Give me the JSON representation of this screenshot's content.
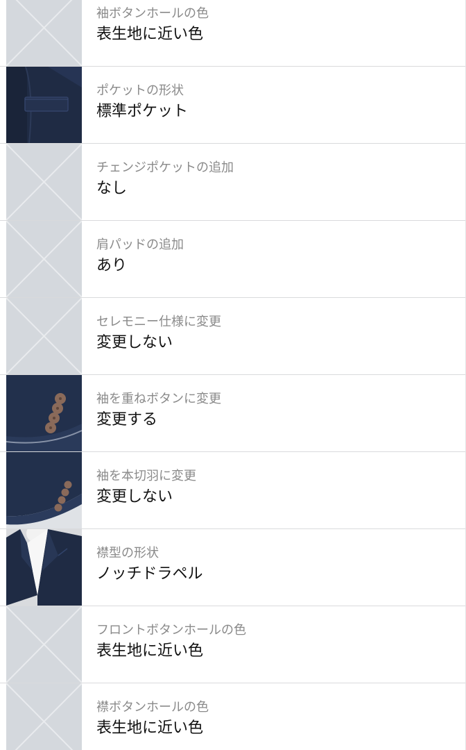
{
  "options": [
    {
      "label": "袖ボタンホールの色",
      "value": "表生地に近い色",
      "image": "placeholder"
    },
    {
      "label": "ポケットの形状",
      "value": "標準ポケット",
      "image": "pocket-photo"
    },
    {
      "label": "チェンジポケットの追加",
      "value": "なし",
      "image": "placeholder"
    },
    {
      "label": "肩パッドの追加",
      "value": "あり",
      "image": "placeholder"
    },
    {
      "label": "セレモニー仕様に変更",
      "value": "変更しない",
      "image": "placeholder"
    },
    {
      "label": "袖を重ねボタンに変更",
      "value": "変更する",
      "image": "sleeve-stacked-buttons-photo"
    },
    {
      "label": "袖を本切羽に変更",
      "value": "変更しない",
      "image": "sleeve-buttons-photo"
    },
    {
      "label": "襟型の形状",
      "value": "ノッチドラペル",
      "image": "lapel-photo"
    },
    {
      "label": "フロントボタンホールの色",
      "value": "表生地に近い色",
      "image": "placeholder"
    },
    {
      "label": "襟ボタンホールの色",
      "value": "表生地に近い色",
      "image": "placeholder"
    }
  ],
  "colors": {
    "placeholder_bg": "#d4d8dd",
    "placeholder_line": "#e9ebee",
    "fabric_navy": "#1f2b44",
    "button_brown": "#8a6a5a",
    "divider": "#d9dadc",
    "label_gray": "#8a8a8a",
    "value_black": "#111111"
  }
}
